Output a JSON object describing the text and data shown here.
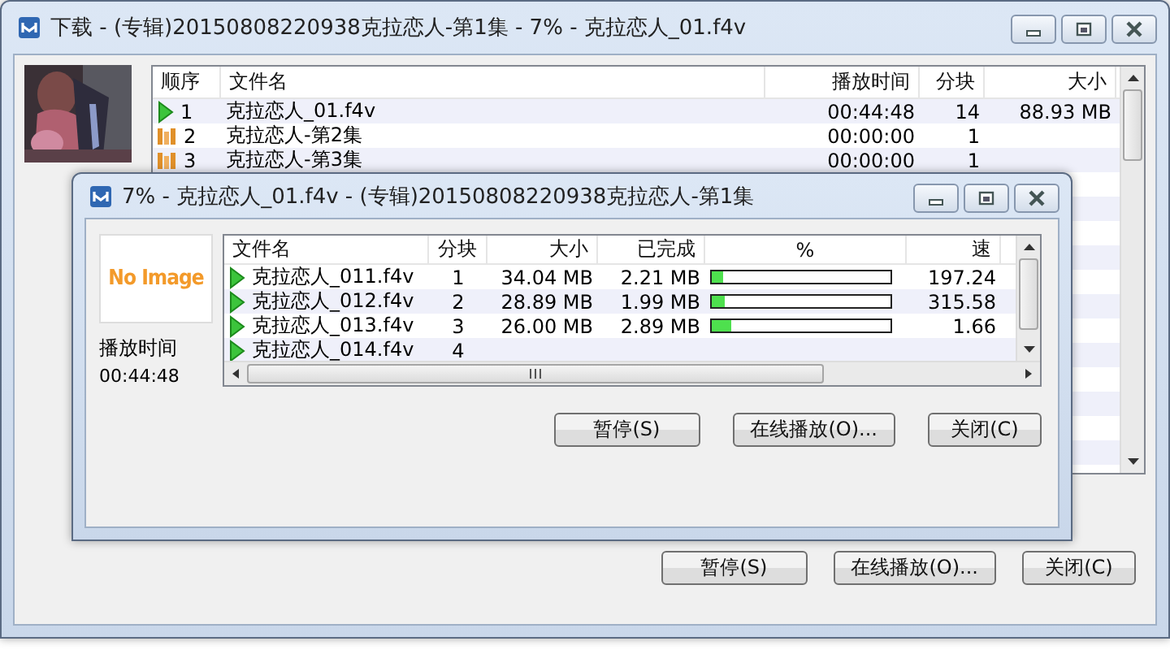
{
  "main_window": {
    "title": "下载 - (专辑)20150808220938克拉恋人-第1集 - 7% - 克拉恋人_01.f4v",
    "thumbnail": {
      "kind": "picture"
    },
    "table": {
      "columns": [
        "顺序",
        "文件名",
        "播放时间",
        "分块",
        "大小"
      ],
      "rows": [
        {
          "kind": "playing",
          "order": "1",
          "name": "克拉恋人_01.f4v",
          "play_time": "00:44:48",
          "blocks": "14",
          "size": "88.93 MB"
        },
        {
          "kind": "waiting",
          "order": "2",
          "name": "克拉恋人-第2集",
          "play_time": "00:00:00",
          "blocks": "1"
        },
        {
          "kind": "waiting",
          "order": "3",
          "name": "克拉恋人-第3集",
          "play_time": "00:00:00",
          "blocks": "1"
        }
      ]
    },
    "buttons": [
      "暂停(S)",
      "在线播放(O)...",
      "关闭(C)"
    ]
  },
  "progress_window": {
    "title": "7% - 克拉恋人_01.f4v - (专辑)20150808220938克拉恋人-第1集",
    "no_image_text": "No Image",
    "play_time_label": "播放时间",
    "play_time": "00:44:48",
    "table": {
      "columns": [
        "文件名",
        "分块",
        "大小",
        "已完成",
        "%",
        "速"
      ],
      "rows": [
        {
          "kind": "playing",
          "name": "克拉恋人_011.f4v",
          "blocks": "1",
          "size": "34.04 MB",
          "done": "2.21 MB",
          "level": 0.06,
          "speed": "197.24"
        },
        {
          "kind": "playing",
          "name": "克拉恋人_012.f4v",
          "blocks": "2",
          "size": "28.89 MB",
          "done": "1.99 MB",
          "level": 0.07,
          "speed": "315.58"
        },
        {
          "kind": "playing",
          "name": "克拉恋人_013.f4v",
          "blocks": "3",
          "size": "26.00 MB",
          "done": "2.89 MB",
          "level": 0.11,
          "speed": "1.66"
        },
        {
          "kind": "playing",
          "name": "克拉恋人_014.f4v",
          "blocks": "4"
        }
      ]
    },
    "buttons": [
      "暂停(S)",
      "在线播放(O)...",
      "关闭(C)"
    ]
  }
}
